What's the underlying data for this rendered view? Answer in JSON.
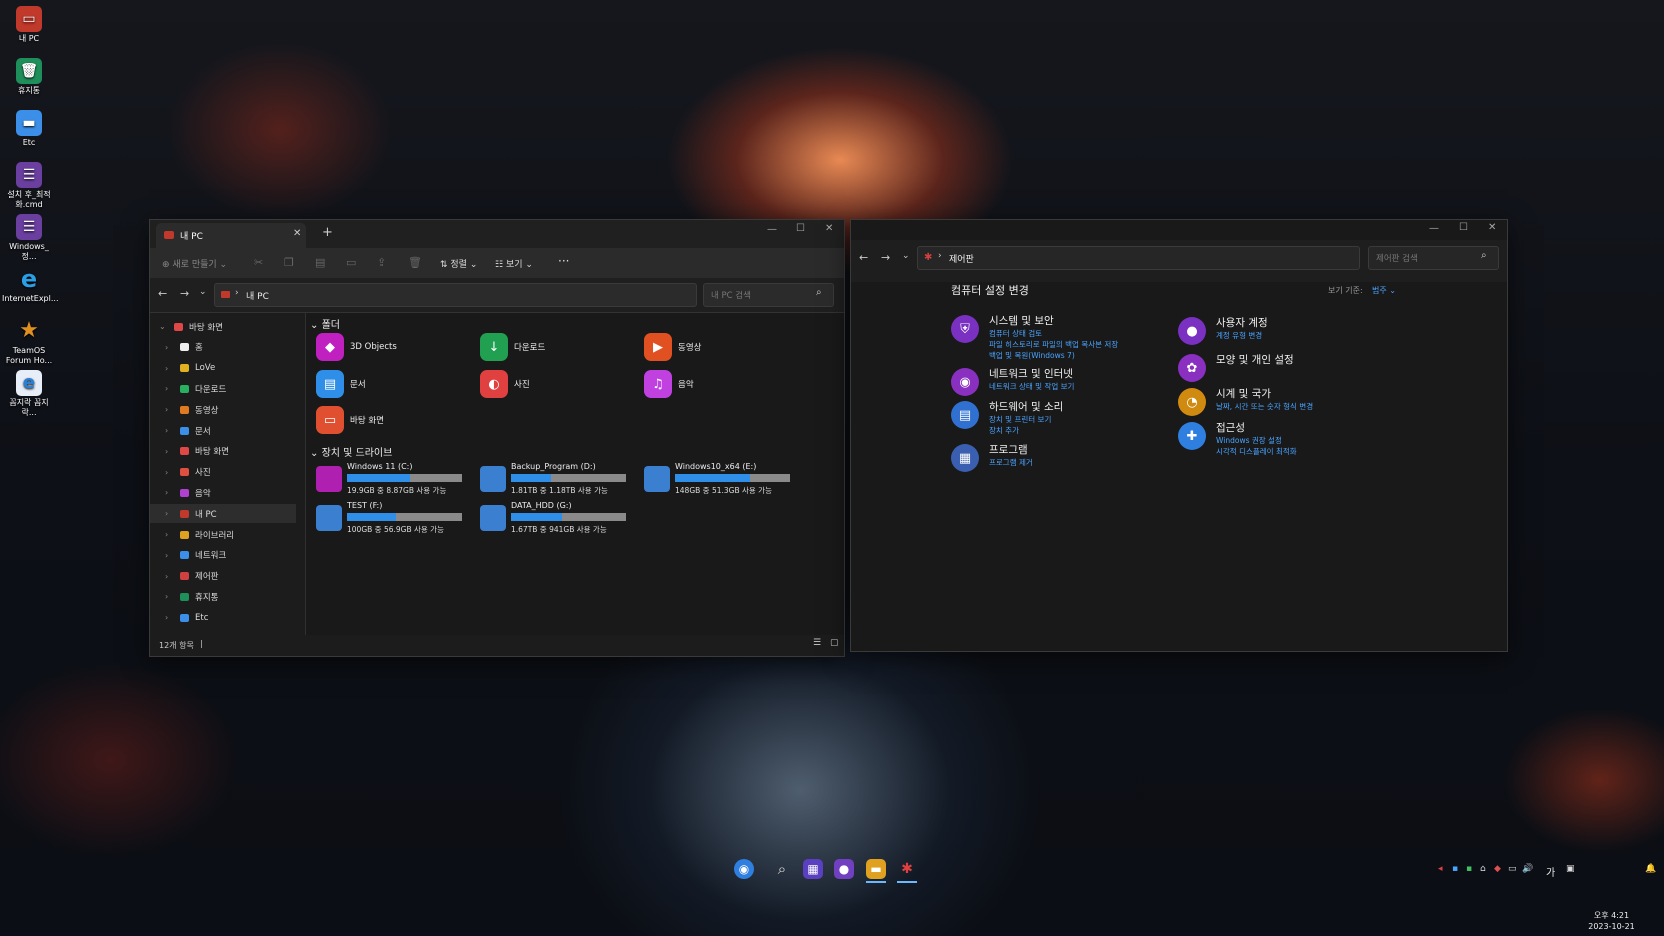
{
  "desktop_icons": [
    {
      "label": "내 PC",
      "icon": "pc-icon",
      "color": "#c0392b"
    },
    {
      "label": "휴지통",
      "icon": "recycle-bin-icon",
      "color": "#1e8e5a"
    },
    {
      "label": "Etc",
      "icon": "folder-icon",
      "color": "#3b8fe8"
    },
    {
      "label": "설치 후_최적화.cmd",
      "icon": "cmd-icon",
      "color": "#6a3fa0"
    },
    {
      "label": "Windows_정...",
      "icon": "cmd-icon",
      "color": "#6a3fa0"
    },
    {
      "label": "InternetExpl...",
      "icon": "ie-icon",
      "color": "#2a7fd6"
    },
    {
      "label": "TeamOS Forum Ho...",
      "icon": "star-icon",
      "color": "#e09020"
    },
    {
      "label": "꼼지락 꼼지락...",
      "icon": "ie-icon",
      "color": "#2a7fd6"
    }
  ],
  "explorer": {
    "tab_title": "내 PC",
    "new_tab": "+",
    "toolbar": {
      "new": "새로 만들기",
      "sort": "정렬",
      "view": "보기",
      "more": "···"
    },
    "address": "내 PC",
    "search_placeholder": "내 PC 검색",
    "sidebar": [
      {
        "label": "바탕 화면",
        "color": "#e04848",
        "expanded": true
      },
      {
        "label": "홈",
        "color": "#eeeeee"
      },
      {
        "label": "LoVe",
        "color": "#e0b020"
      },
      {
        "label": "다운로드",
        "color": "#28b060"
      },
      {
        "label": "동영상",
        "color": "#e07a20"
      },
      {
        "label": "문서",
        "color": "#3b8fe8"
      },
      {
        "label": "바탕 화면",
        "color": "#e04848"
      },
      {
        "label": "사진",
        "color": "#e05040"
      },
      {
        "label": "음악",
        "color": "#b040d0"
      },
      {
        "label": "내 PC",
        "color": "#c0392b",
        "selected": true
      },
      {
        "label": "라이브러리",
        "color": "#e0a020"
      },
      {
        "label": "네트워크",
        "color": "#3b8fe8"
      },
      {
        "label": "제어판",
        "color": "#d04040"
      },
      {
        "label": "휴지통",
        "color": "#1e8e5a"
      },
      {
        "label": "Etc",
        "color": "#3b8fe8"
      }
    ],
    "folders_header": "폴더",
    "folders": [
      {
        "label": "3D Objects",
        "color": "#c020c0",
        "icon": "cube-icon"
      },
      {
        "label": "다운로드",
        "color": "#20a050",
        "icon": "download-icon"
      },
      {
        "label": "동영상",
        "color": "#e05020",
        "icon": "video-icon"
      },
      {
        "label": "문서",
        "color": "#2f8fe8",
        "icon": "document-icon"
      },
      {
        "label": "사진",
        "color": "#e04040",
        "icon": "photo-icon"
      },
      {
        "label": "음악",
        "color": "#c040e0",
        "icon": "music-icon"
      },
      {
        "label": "바탕 화면",
        "color": "#e05030",
        "icon": "desktop-icon"
      }
    ],
    "drives_header": "장치 및 드라이브",
    "drives": [
      {
        "name": "Windows 11 (C:)",
        "stats": "19.9GB 중 8.87GB 사용 가능",
        "used": 0.55,
        "color": "#b020b0"
      },
      {
        "name": "Backup_Program (D:)",
        "stats": "1.81TB 중 1.18TB 사용 가능",
        "used": 0.35,
        "color": "#3b7fd0"
      },
      {
        "name": "Windows10_x64 (E:)",
        "stats": "148GB 중 51.3GB 사용 가능",
        "used": 0.65,
        "color": "#3b7fd0"
      },
      {
        "name": "TEST (F:)",
        "stats": "100GB 중 56.9GB 사용 가능",
        "used": 0.43,
        "color": "#3b7fd0"
      },
      {
        "name": "DATA_HDD (G:)",
        "stats": "1.67TB 중 941GB 사용 가능",
        "used": 0.44,
        "color": "#3b7fd0"
      }
    ],
    "status": "12개 항목"
  },
  "control_panel": {
    "address": "제어판",
    "search_placeholder": "제어판 검색",
    "heading": "컴퓨터 설정 변경",
    "view_by_label": "보기 기준:",
    "view_by_value": "범주",
    "categories_left": [
      {
        "title": "시스템 및 보안",
        "color": "#7a30c0",
        "icon": "shield-icon",
        "links": [
          "컴퓨터 상태 검토",
          "파일 히스토리로 파일의 백업 복사본 저장",
          "백업 및 복원(Windows 7)"
        ]
      },
      {
        "title": "네트워크 및 인터넷",
        "color": "#8a30c0",
        "icon": "network-icon",
        "links": [
          "네트워크 상태 및 작업 보기"
        ]
      },
      {
        "title": "하드웨어 및 소리",
        "color": "#3070d0",
        "icon": "printer-icon",
        "links": [
          "장치 및 프린터 보기",
          "장치 추가"
        ]
      },
      {
        "title": "프로그램",
        "color": "#3a5fb0",
        "icon": "programs-icon",
        "links": [
          "프로그램 제거"
        ]
      }
    ],
    "categories_right": [
      {
        "title": "사용자 계정",
        "color": "#7a30c0",
        "icon": "user-icon",
        "links": [
          "계정 유형 변경"
        ]
      },
      {
        "title": "모양 및 개인 설정",
        "color": "#8a30c0",
        "icon": "palette-icon",
        "links": []
      },
      {
        "title": "시계 및 국가",
        "color": "#d08a10",
        "icon": "clock-icon",
        "links": [
          "날짜, 시간 또는 숫자 형식 변경"
        ]
      },
      {
        "title": "접근성",
        "color": "#2f7fe0",
        "icon": "accessibility-icon",
        "links": [
          "Windows 권장 설정",
          "시각적 디스플레이 최적화"
        ]
      }
    ]
  },
  "taskbar": {
    "time": "오후 4:21",
    "date": "2023-10-21",
    "ime": "가"
  }
}
